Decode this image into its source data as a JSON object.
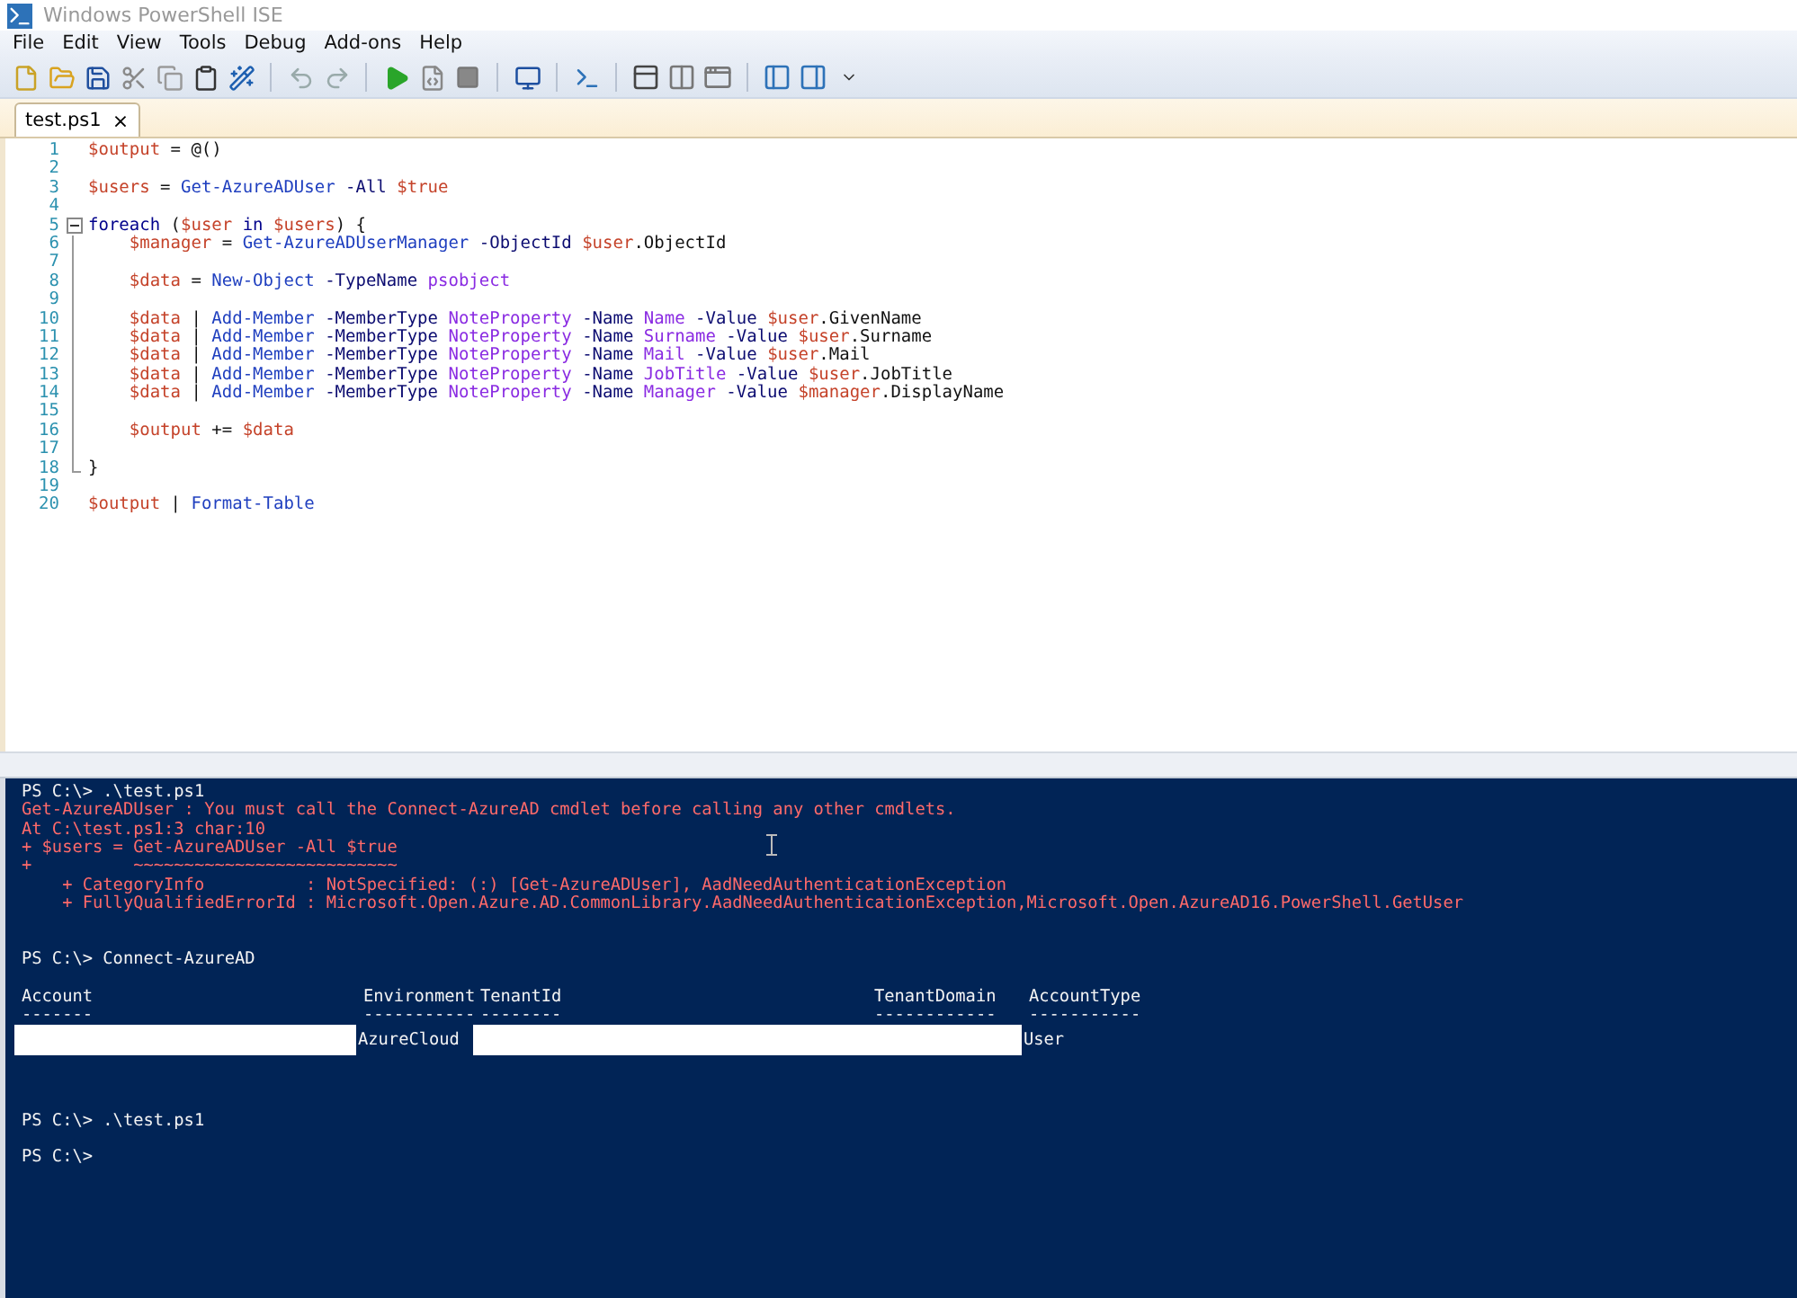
{
  "window": {
    "title": "Windows PowerShell ISE"
  },
  "menu": [
    "File",
    "Edit",
    "View",
    "Tools",
    "Debug",
    "Add-ons",
    "Help"
  ],
  "tabs": [
    {
      "label": "test.ps1",
      "close": "×",
      "selected": true
    }
  ],
  "editor": {
    "lines": [
      {
        "number": "1",
        "tokens": [
          {
            "kind": "var",
            "text": "$output"
          },
          {
            "kind": "plain",
            "text": " = @()"
          }
        ]
      },
      {
        "number": "2"
      },
      {
        "number": "3",
        "tokens": [
          {
            "kind": "var",
            "text": "$users"
          },
          {
            "kind": "plain",
            "text": " ="
          },
          {
            "kind": "cmd",
            "text": " Get-AzureADUser"
          },
          {
            "kind": "param",
            "text": " -All"
          },
          {
            "kind": "var",
            "text": " $true"
          }
        ]
      },
      {
        "number": "4"
      },
      {
        "number": "5",
        "kind": "fold_start",
        "tokens": [
          {
            "kind": "kw",
            "text": "foreach"
          },
          {
            "kind": "plain",
            "text": " ("
          },
          {
            "kind": "var",
            "text": "$user"
          },
          {
            "kind": "kw",
            "text": " in"
          },
          {
            "kind": "var",
            "text": " $users"
          },
          {
            "kind": "plain",
            "text": ") {"
          }
        ]
      },
      {
        "number": "6",
        "kind": "fold_body",
        "tokens": [
          {
            "kind": "var",
            "text": "    $manager"
          },
          {
            "kind": "plain",
            "text": " ="
          },
          {
            "kind": "cmd",
            "text": " Get-AzureADUserManager"
          },
          {
            "kind": "param",
            "text": " -ObjectId"
          },
          {
            "kind": "var",
            "text": " $user"
          },
          {
            "kind": "plain",
            "text": ".ObjectId"
          }
        ]
      },
      {
        "number": "7",
        "kind": "fold_body"
      },
      {
        "number": "8",
        "kind": "fold_body",
        "tokens": [
          {
            "kind": "var",
            "text": "    $data"
          },
          {
            "kind": "plain",
            "text": " ="
          },
          {
            "kind": "cmd",
            "text": " New-Object"
          },
          {
            "kind": "param",
            "text": " -TypeName"
          },
          {
            "kind": "arg",
            "text": " psobject"
          }
        ]
      },
      {
        "number": "9",
        "kind": "fold_body"
      },
      {
        "number": "10",
        "kind": "fold_body",
        "tokens": [
          {
            "kind": "var",
            "text": "    $data"
          },
          {
            "kind": "plain",
            "text": " |"
          },
          {
            "kind": "cmd",
            "text": " Add-Member"
          },
          {
            "kind": "param",
            "text": " -MemberType"
          },
          {
            "kind": "arg",
            "text": " NoteProperty"
          },
          {
            "kind": "param",
            "text": " -Name"
          },
          {
            "kind": "arg",
            "text": " Name"
          },
          {
            "kind": "param",
            "text": " -Value"
          },
          {
            "kind": "var",
            "text": " $user"
          },
          {
            "kind": "plain",
            "text": ".GivenName"
          }
        ]
      },
      {
        "number": "11",
        "kind": "fold_body",
        "tokens": [
          {
            "kind": "var",
            "text": "    $data"
          },
          {
            "kind": "plain",
            "text": " |"
          },
          {
            "kind": "cmd",
            "text": " Add-Member"
          },
          {
            "kind": "param",
            "text": " -MemberType"
          },
          {
            "kind": "arg",
            "text": " NoteProperty"
          },
          {
            "kind": "param",
            "text": " -Name"
          },
          {
            "kind": "arg",
            "text": " Surname"
          },
          {
            "kind": "param",
            "text": " -Value"
          },
          {
            "kind": "var",
            "text": " $user"
          },
          {
            "kind": "plain",
            "text": ".Surname"
          }
        ]
      },
      {
        "number": "12",
        "kind": "fold_body",
        "tokens": [
          {
            "kind": "var",
            "text": "    $data"
          },
          {
            "kind": "plain",
            "text": " |"
          },
          {
            "kind": "cmd",
            "text": " Add-Member"
          },
          {
            "kind": "param",
            "text": " -MemberType"
          },
          {
            "kind": "arg",
            "text": " NoteProperty"
          },
          {
            "kind": "param",
            "text": " -Name"
          },
          {
            "kind": "arg",
            "text": " Mail"
          },
          {
            "kind": "param",
            "text": " -Value"
          },
          {
            "kind": "var",
            "text": " $user"
          },
          {
            "kind": "plain",
            "text": ".Mail"
          }
        ]
      },
      {
        "number": "13",
        "kind": "fold_body",
        "tokens": [
          {
            "kind": "var",
            "text": "    $data"
          },
          {
            "kind": "plain",
            "text": " |"
          },
          {
            "kind": "cmd",
            "text": " Add-Member"
          },
          {
            "kind": "param",
            "text": " -MemberType"
          },
          {
            "kind": "arg",
            "text": " NoteProperty"
          },
          {
            "kind": "param",
            "text": " -Name"
          },
          {
            "kind": "arg",
            "text": " JobTitle"
          },
          {
            "kind": "param",
            "text": " -Value"
          },
          {
            "kind": "var",
            "text": " $user"
          },
          {
            "kind": "plain",
            "text": ".JobTitle"
          }
        ]
      },
      {
        "number": "14",
        "kind": "fold_body",
        "tokens": [
          {
            "kind": "var",
            "text": "    $data"
          },
          {
            "kind": "plain",
            "text": " |"
          },
          {
            "kind": "cmd",
            "text": " Add-Member"
          },
          {
            "kind": "param",
            "text": " -MemberType"
          },
          {
            "kind": "arg",
            "text": " NoteProperty"
          },
          {
            "kind": "param",
            "text": " -Name"
          },
          {
            "kind": "arg",
            "text": " Manager"
          },
          {
            "kind": "param",
            "text": " -Value"
          },
          {
            "kind": "var",
            "text": " $manager"
          },
          {
            "kind": "plain",
            "text": ".DisplayName"
          }
        ]
      },
      {
        "number": "15",
        "kind": "fold_body"
      },
      {
        "number": "16",
        "kind": "fold_body",
        "tokens": [
          {
            "kind": "var",
            "text": "    $output"
          },
          {
            "kind": "plain",
            "text": " +="
          },
          {
            "kind": "var",
            "text": " $data"
          }
        ]
      },
      {
        "number": "17",
        "kind": "fold_body"
      },
      {
        "number": "18",
        "kind": "fold_end",
        "tokens": [
          {
            "kind": "plain",
            "text": "}"
          }
        ]
      },
      {
        "number": "19"
      },
      {
        "number": "20",
        "tokens": [
          {
            "kind": "var",
            "text": "$output"
          },
          {
            "kind": "plain",
            "text": " |"
          },
          {
            "kind": "cmd",
            "text": " Format-Table"
          }
        ]
      }
    ]
  },
  "console": {
    "blocks": [
      {
        "kind": "text",
        "lines": [
          {
            "kind": "output",
            "text": "PS C:\\> .\\test.ps1"
          },
          {
            "kind": "error",
            "text": "Get-AzureADUser : You must call the Connect-AzureAD cmdlet before calling any other cmdlets."
          },
          {
            "kind": "error",
            "text": "At C:\\test.ps1:3 char:10"
          },
          {
            "kind": "error",
            "text": "+ $users = Get-AzureADUser -All $true"
          },
          {
            "kind": "error",
            "text": "+          ~~~~~~~~~~~~~~~~~~~~~~~~~~"
          },
          {
            "kind": "error",
            "text": "    + CategoryInfo          : NotSpecified: (:) [Get-AzureADUser], AadNeedAuthenticationException"
          },
          {
            "kind": "error",
            "text": "    + FullyQualifiedErrorId : Microsoft.Open.Azure.AD.CommonLibrary.AadNeedAuthenticationException,Microsoft.Open.AzureAD16.PowerShell.GetUser"
          },
          {
            "kind": "blank"
          },
          {
            "kind": "blank"
          },
          {
            "kind": "output",
            "text": "PS C:\\> Connect-AzureAD"
          },
          {
            "kind": "blank"
          }
        ]
      },
      {
        "kind": "table",
        "columns": [
          {
            "header": "Account",
            "rule": "-------"
          },
          {
            "header": "Environment",
            "rule": "-----------"
          },
          {
            "header": "TenantId",
            "rule": "--------"
          },
          {
            "header": "TenantDomain",
            "rule": "------------"
          },
          {
            "header": "AccountType",
            "rule": "-----------"
          }
        ],
        "rows": [
          [
            {
              "redacted": true
            },
            {
              "text": "AzureCloud",
              "redacted": false
            },
            {
              "redacted": true
            },
            {
              "redacted": true
            },
            {
              "text": "User",
              "redacted": false
            }
          ]
        ]
      },
      {
        "kind": "text",
        "lines": [
          {
            "kind": "blank"
          },
          {
            "kind": "blank"
          },
          {
            "kind": "blank"
          },
          {
            "kind": "output",
            "text": "PS C:\\> .\\test.ps1"
          },
          {
            "kind": "blank"
          },
          {
            "kind": "output",
            "text": "PS C:\\>"
          }
        ]
      }
    ]
  }
}
